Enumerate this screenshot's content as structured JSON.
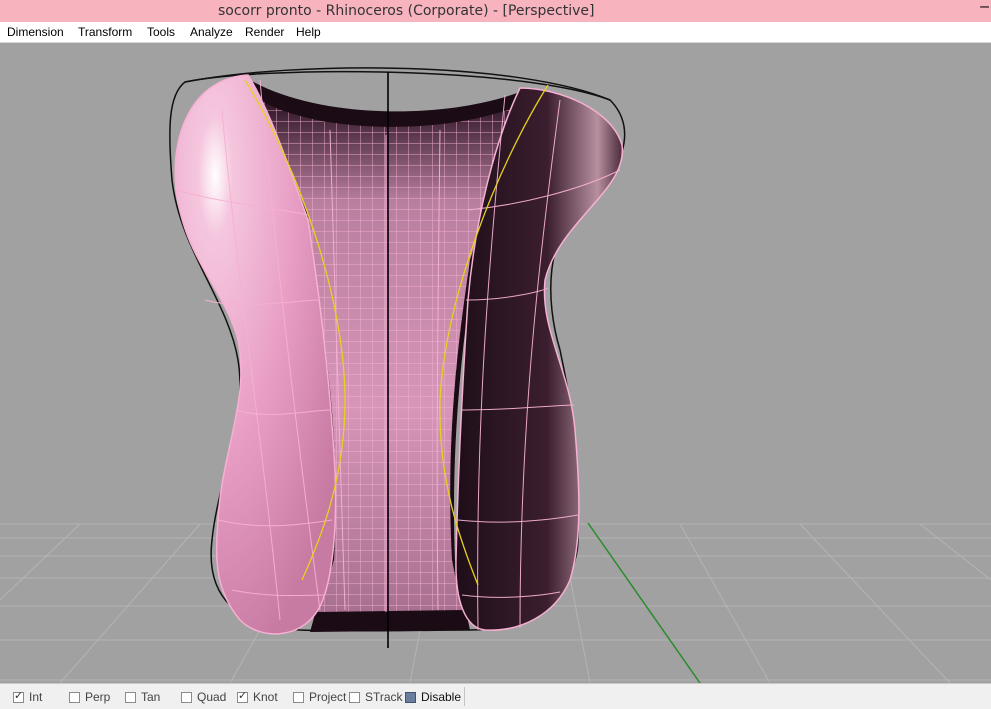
{
  "window": {
    "title": "socorr pronto - Rhinoceros (Corporate) - [Perspective]",
    "minimize_glyph": "–"
  },
  "menu": {
    "items": [
      "Dimension",
      "Transform",
      "Tools",
      "Analyze",
      "Render",
      "Help"
    ]
  },
  "viewport": {
    "name": "Perspective",
    "background_color": "#a1a1a1",
    "surface_color": "#e8a3c6",
    "wire_color": "#f6b0d2",
    "curve_color": "#e6d21a",
    "axis_color": "#2a8c2a"
  },
  "statusbar": {
    "osnaps": [
      {
        "label": "Int",
        "checked": true
      },
      {
        "label": "Perp",
        "checked": false
      },
      {
        "label": "Tan",
        "checked": false
      },
      {
        "label": "Quad",
        "checked": false
      },
      {
        "label": "Knot",
        "checked": true
      },
      {
        "label": "Project",
        "checked": false
      },
      {
        "label": "STrack",
        "checked": false
      }
    ],
    "disable": {
      "label": "Disable",
      "checked": true
    }
  }
}
